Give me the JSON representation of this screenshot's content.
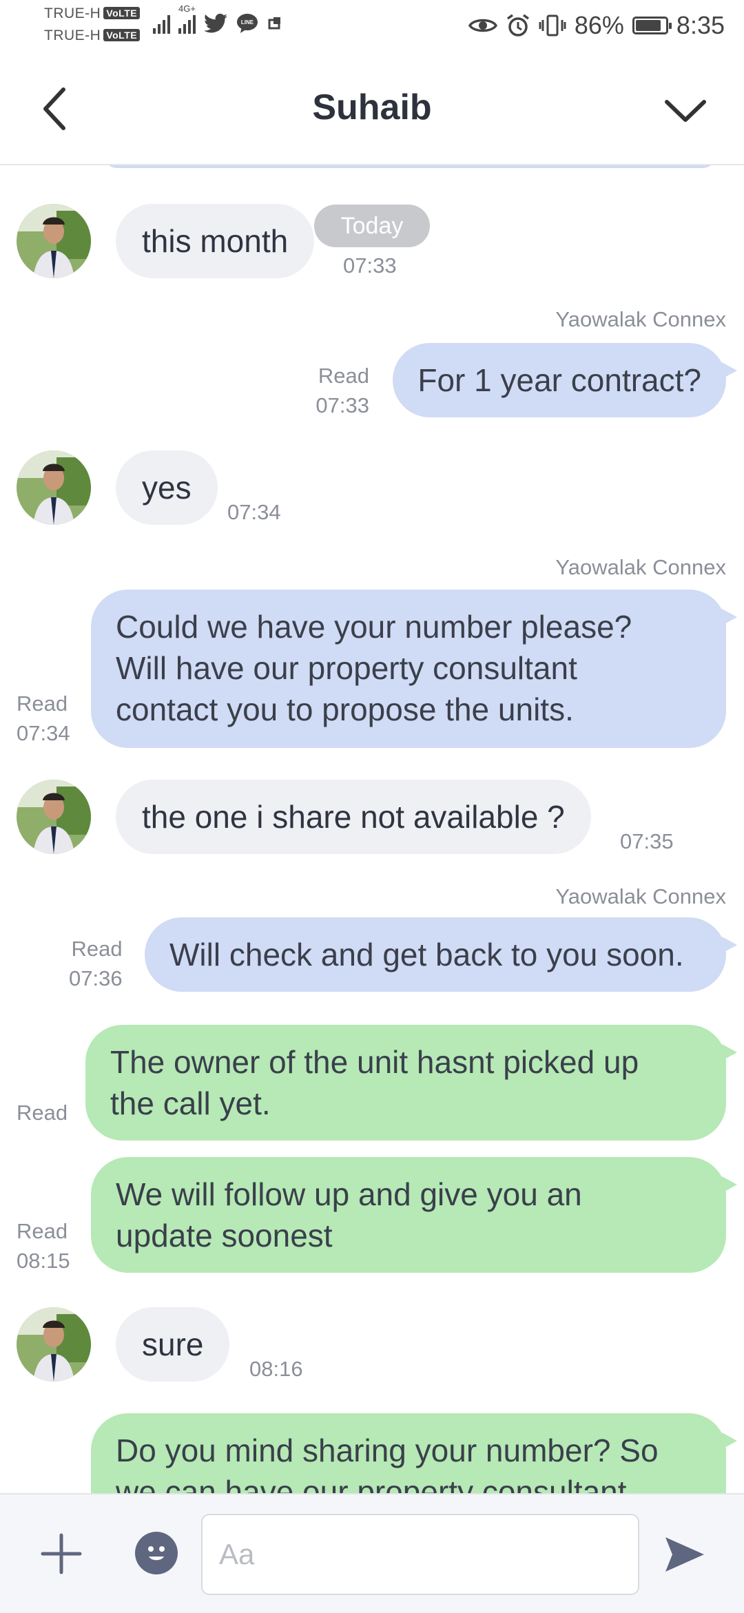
{
  "status_bar": {
    "carrier_1": "TRUE-H",
    "carrier_2": "TRUE-H",
    "volte": "VoLTE",
    "network": "4G+",
    "battery_percent": "86%",
    "battery_level": 0.86,
    "time": "8:35"
  },
  "header": {
    "title": "Suhaib",
    "back_icon": "chevron-left-icon",
    "menu_icon": "chevron-down-icon"
  },
  "date_badge": "Today",
  "messages": [
    {
      "side": "in",
      "text": "this month",
      "time": "07:33"
    },
    {
      "side": "out",
      "sender": "Yaowalak Connex",
      "status": "Read",
      "time": "07:33",
      "text": "For 1 year contract?"
    },
    {
      "side": "in",
      "text": "yes",
      "time": "07:34"
    },
    {
      "side": "out",
      "sender": "Yaowalak Connex",
      "status": "Read",
      "time": "07:34",
      "lines": [
        "Could we have your number please?",
        "Will have our property consultant",
        "contact you to propose the units."
      ]
    },
    {
      "side": "in",
      "text": "the one i share not available ?",
      "time": "07:35"
    },
    {
      "side": "out",
      "sender": "Yaowalak Connex",
      "status": "Read",
      "time": "07:36",
      "text": "Will check and get back to you soon."
    },
    {
      "side": "out",
      "status": "Read",
      "lines": [
        "The owner of the unit hasnt picked up",
        "the call yet."
      ]
    },
    {
      "side": "out",
      "status": "Read",
      "time": "08:15",
      "lines": [
        "We will follow up and give you an",
        "update soonest"
      ]
    },
    {
      "side": "in",
      "text": "sure",
      "time": "08:16"
    },
    {
      "side": "out",
      "lines": [
        "Do you mind sharing your number? So",
        "we can have our property consultant"
      ]
    }
  ],
  "input": {
    "placeholder": "Aa",
    "plus_icon": "plus-icon",
    "emoji_icon": "emoji-icon",
    "send_icon": "send-icon"
  },
  "colors": {
    "incoming_bubble": "#eef0f3",
    "outgoing_bubble": "#d0dbf5",
    "outgoing_green_bubble": "#b6e9b5"
  }
}
